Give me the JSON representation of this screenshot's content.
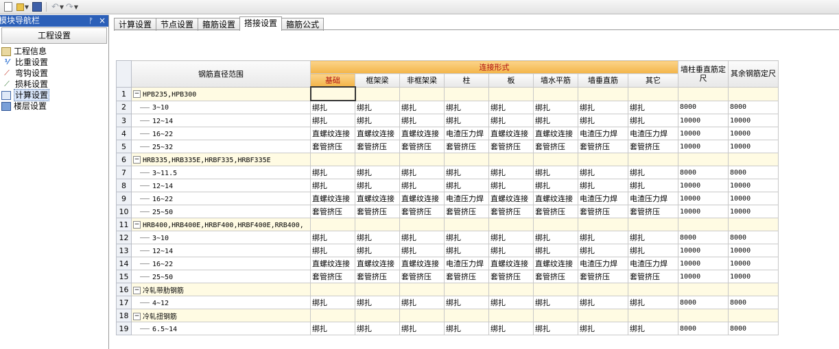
{
  "nav": {
    "title": "模块导航栏",
    "pin": "ᅟ",
    "close": "×",
    "section": "工程设置",
    "items": [
      {
        "label": "工程信息",
        "icon": "info-icon"
      },
      {
        "label": "比重设置",
        "icon": "weight-icon"
      },
      {
        "label": "弯钩设置",
        "icon": "hook-icon"
      },
      {
        "label": "损耗设置",
        "icon": "loss-icon"
      },
      {
        "label": "计算设置",
        "icon": "calc-icon",
        "selected": true
      },
      {
        "label": "楼层设置",
        "icon": "floor-icon"
      }
    ]
  },
  "tabs": [
    "计算设置",
    "节点设置",
    "箍筋设置",
    "搭接设置",
    "箍筋公式"
  ],
  "active_tab": 3,
  "grid": {
    "range_header": "钢筋直径范围",
    "conn_header": "连接形式",
    "conn_cols": [
      "基础",
      "框架梁",
      "非框架梁",
      "柱",
      "板",
      "墙水平筋",
      "墙垂直筋",
      "其它"
    ],
    "wall_fix_header": "墙柱垂直筋定尺",
    "other_fix_header": "其余钢筋定尺",
    "rows": [
      {
        "n": "1",
        "group": true,
        "label": "HPB235,HPB300"
      },
      {
        "n": "2",
        "label": "3~10",
        "vals": [
          "绑扎",
          "绑扎",
          "绑扎",
          "绑扎",
          "绑扎",
          "绑扎",
          "绑扎",
          "绑扎"
        ],
        "wall": "8000",
        "other": "8000"
      },
      {
        "n": "3",
        "label": "12~14",
        "vals": [
          "绑扎",
          "绑扎",
          "绑扎",
          "绑扎",
          "绑扎",
          "绑扎",
          "绑扎",
          "绑扎"
        ],
        "wall": "10000",
        "other": "10000"
      },
      {
        "n": "4",
        "label": "16~22",
        "vals": [
          "直螺纹连接",
          "直螺纹连接",
          "直螺纹连接",
          "电渣压力焊",
          "直螺纹连接",
          "直螺纹连接",
          "电渣压力焊",
          "电渣压力焊"
        ],
        "wall": "10000",
        "other": "10000"
      },
      {
        "n": "5",
        "label": "25~32",
        "vals": [
          "套管挤压",
          "套管挤压",
          "套管挤压",
          "套管挤压",
          "套管挤压",
          "套管挤压",
          "套管挤压",
          "套管挤压"
        ],
        "wall": "10000",
        "other": "10000"
      },
      {
        "n": "6",
        "group": true,
        "label": "HRB335,HRB335E,HRBF335,HRBF335E"
      },
      {
        "n": "7",
        "label": "3~11.5",
        "vals": [
          "绑扎",
          "绑扎",
          "绑扎",
          "绑扎",
          "绑扎",
          "绑扎",
          "绑扎",
          "绑扎"
        ],
        "wall": "8000",
        "other": "8000"
      },
      {
        "n": "8",
        "label": "12~14",
        "vals": [
          "绑扎",
          "绑扎",
          "绑扎",
          "绑扎",
          "绑扎",
          "绑扎",
          "绑扎",
          "绑扎"
        ],
        "wall": "10000",
        "other": "10000"
      },
      {
        "n": "9",
        "label": "16~22",
        "vals": [
          "直螺纹连接",
          "直螺纹连接",
          "直螺纹连接",
          "电渣压力焊",
          "直螺纹连接",
          "直螺纹连接",
          "电渣压力焊",
          "电渣压力焊"
        ],
        "wall": "10000",
        "other": "10000"
      },
      {
        "n": "10",
        "label": "25~50",
        "vals": [
          "套管挤压",
          "套管挤压",
          "套管挤压",
          "套管挤压",
          "套管挤压",
          "套管挤压",
          "套管挤压",
          "套管挤压"
        ],
        "wall": "10000",
        "other": "10000"
      },
      {
        "n": "11",
        "group": true,
        "label": "HRB400,HRB400E,HRBF400,HRBF400E,RRB400,"
      },
      {
        "n": "12",
        "label": "3~10",
        "vals": [
          "绑扎",
          "绑扎",
          "绑扎",
          "绑扎",
          "绑扎",
          "绑扎",
          "绑扎",
          "绑扎"
        ],
        "wall": "8000",
        "other": "8000"
      },
      {
        "n": "13",
        "label": "12~14",
        "vals": [
          "绑扎",
          "绑扎",
          "绑扎",
          "绑扎",
          "绑扎",
          "绑扎",
          "绑扎",
          "绑扎"
        ],
        "wall": "10000",
        "other": "10000"
      },
      {
        "n": "14",
        "label": "16~22",
        "vals": [
          "直螺纹连接",
          "直螺纹连接",
          "直螺纹连接",
          "电渣压力焊",
          "直螺纹连接",
          "直螺纹连接",
          "电渣压力焊",
          "电渣压力焊"
        ],
        "wall": "10000",
        "other": "10000"
      },
      {
        "n": "15",
        "label": "25~50",
        "vals": [
          "套管挤压",
          "套管挤压",
          "套管挤压",
          "套管挤压",
          "套管挤压",
          "套管挤压",
          "套管挤压",
          "套管挤压"
        ],
        "wall": "10000",
        "other": "10000"
      },
      {
        "n": "16",
        "group": true,
        "label": "冷轧带肋钢筋"
      },
      {
        "n": "17",
        "label": "4~12",
        "vals": [
          "绑扎",
          "绑扎",
          "绑扎",
          "绑扎",
          "绑扎",
          "绑扎",
          "绑扎",
          "绑扎"
        ],
        "wall": "8000",
        "other": "8000"
      },
      {
        "n": "18",
        "group": true,
        "label": "冷轧扭钢筋"
      },
      {
        "n": "19",
        "label": "6.5~14",
        "vals": [
          "绑扎",
          "绑扎",
          "绑扎",
          "绑扎",
          "绑扎",
          "绑扎",
          "绑扎",
          "绑扎"
        ],
        "wall": "8000",
        "other": "8000"
      }
    ]
  }
}
